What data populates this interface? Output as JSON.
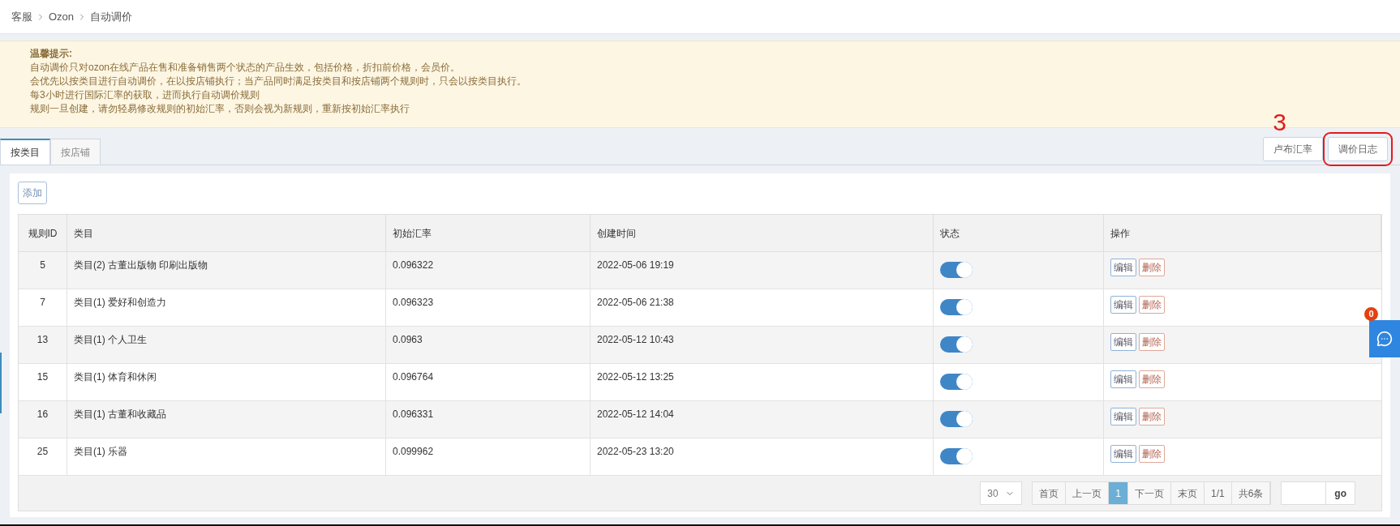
{
  "breadcrumb": [
    "客服",
    "Ozon",
    "自动调价"
  ],
  "notice": {
    "title": "温馨提示:",
    "lines": [
      "自动调价只对ozon在线产品在售和准备销售两个状态的产品生效，包括价格，折扣前价格，会员价。",
      "会优先以按类目进行自动调价，在以按店铺执行；当产品同时满足按类目和按店铺两个规则时，只会以按类目执行。",
      "每3小时进行国际汇率的获取，进而执行自动调价规则",
      "规则一旦创建，请勿轻易修改规则的初始汇率，否则会视为新规则，重新按初始汇率执行"
    ]
  },
  "tabs": [
    {
      "label": "按类目",
      "selected": true
    },
    {
      "label": "按店铺",
      "selected": false
    }
  ],
  "annotation": {
    "number": "3"
  },
  "top_buttons": [
    {
      "label": "卢布汇率",
      "highlighted": false
    },
    {
      "label": "调价日志",
      "highlighted": true
    }
  ],
  "add_button": "添加",
  "table": {
    "columns": [
      "规则ID",
      "类目",
      "初始汇率",
      "创建时间",
      "状态",
      "操作"
    ],
    "rows": [
      {
        "id": "5",
        "category": "类目(2) 古董出版物 印刷出版物",
        "rate": "0.096322",
        "created": "2022-05-06 19:19",
        "on": true,
        "actions": [
          "编辑",
          "删除"
        ]
      },
      {
        "id": "7",
        "category": "类目(1) 爱好和创造力",
        "rate": "0.096323",
        "created": "2022-05-06 21:38",
        "on": true,
        "actions": [
          "编辑",
          "删除"
        ]
      },
      {
        "id": "13",
        "category": "类目(1) 个人卫生",
        "rate": "0.0963",
        "created": "2022-05-12 10:43",
        "on": true,
        "actions": [
          "编辑",
          "删除"
        ]
      },
      {
        "id": "15",
        "category": "类目(1) 体育和休闲",
        "rate": "0.096764",
        "created": "2022-05-12 13:25",
        "on": true,
        "actions": [
          "编辑",
          "删除"
        ]
      },
      {
        "id": "16",
        "category": "类目(1) 古董和收藏品",
        "rate": "0.096331",
        "created": "2022-05-12 14:04",
        "on": true,
        "actions": [
          "编辑",
          "删除"
        ]
      },
      {
        "id": "25",
        "category": "类目(1) 乐器",
        "rate": "0.099962",
        "created": "2022-05-23 13:20",
        "on": true,
        "actions": [
          "编辑",
          "删除"
        ]
      }
    ]
  },
  "pagination": {
    "page_size": "30",
    "pages": [
      {
        "label": "首页",
        "selected": false
      },
      {
        "label": "上一页",
        "selected": false
      },
      {
        "label": "1",
        "selected": true
      },
      {
        "label": "下一页",
        "selected": false
      },
      {
        "label": "末页",
        "selected": false
      },
      {
        "label": "1/1",
        "selected": false
      },
      {
        "label": "共6条",
        "selected": false
      }
    ],
    "go": "go"
  },
  "chat": {
    "badge": "0"
  }
}
